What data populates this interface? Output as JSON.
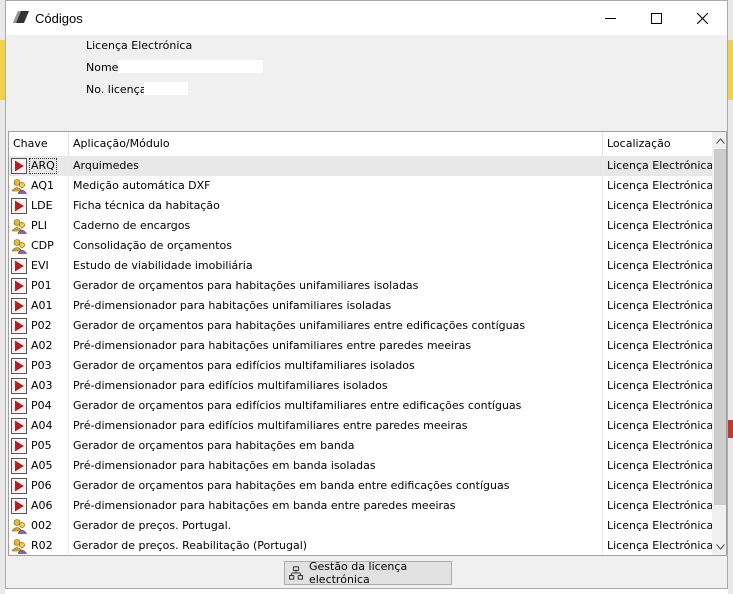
{
  "window": {
    "title": "Códigos"
  },
  "info": {
    "heading": "Licença Electrónica",
    "name_label": "Nome:",
    "name_value": "",
    "license_label": "No. licença:",
    "license_value": ""
  },
  "grid": {
    "columns": {
      "key": "Chave",
      "app": "Aplicação/Módulo",
      "loc": "Localização"
    },
    "rows": [
      {
        "icon": "play-icon",
        "key": "ARQ",
        "app": "Arquimedes",
        "loc": "Licença Electrónica"
      },
      {
        "icon": "users-icon",
        "key": "AQ1",
        "app": "Medição automática DXF",
        "loc": "Licença Electrónica"
      },
      {
        "icon": "play-icon",
        "key": "LDE",
        "app": "Ficha técnica da habitação",
        "loc": "Licença Electrónica"
      },
      {
        "icon": "users-icon",
        "key": "PLI",
        "app": "Caderno de encargos",
        "loc": "Licença Electrónica"
      },
      {
        "icon": "users-icon",
        "key": "CDP",
        "app": "Consolidação de orçamentos",
        "loc": "Licença Electrónica"
      },
      {
        "icon": "play-icon",
        "key": "EVI",
        "app": "Estudo de viabilidade imobiliária",
        "loc": "Licença Electrónica"
      },
      {
        "icon": "play-icon",
        "key": "P01",
        "app": "Gerador de orçamentos para habitações unifamiliares isoladas",
        "loc": "Licença Electrónica"
      },
      {
        "icon": "play-icon",
        "key": "A01",
        "app": "Pré-dimensionador para habitações unifamiliares isoladas",
        "loc": "Licença Electrónica"
      },
      {
        "icon": "play-icon",
        "key": "P02",
        "app": "Gerador de orçamentos para habitações unifamiliares entre edificações contíguas",
        "loc": "Licença Electrónica"
      },
      {
        "icon": "play-icon",
        "key": "A02",
        "app": "Pré-dimensionador para habitações unifamiliares entre paredes meeiras",
        "loc": "Licença Electrónica"
      },
      {
        "icon": "play-icon",
        "key": "P03",
        "app": "Gerador de orçamentos para edifícios multifamiliares isolados",
        "loc": "Licença Electrónica"
      },
      {
        "icon": "play-icon",
        "key": "A03",
        "app": "Pré-dimensionador para edifícios multifamiliares isolados",
        "loc": "Licença Electrónica"
      },
      {
        "icon": "play-icon",
        "key": "P04",
        "app": "Gerador de orçamentos para edifícios multifamiliares entre edificações contíguas",
        "loc": "Licença Electrónica"
      },
      {
        "icon": "play-icon",
        "key": "A04",
        "app": "Pré-dimensionador para edifícios multifamiliares entre paredes meeiras",
        "loc": "Licença Electrónica"
      },
      {
        "icon": "play-icon",
        "key": "P05",
        "app": "Gerador de orçamentos para habitações em banda",
        "loc": "Licença Electrónica"
      },
      {
        "icon": "play-icon",
        "key": "A05",
        "app": "Pré-dimensionador para habitações em banda isoladas",
        "loc": "Licença Electrónica"
      },
      {
        "icon": "play-icon",
        "key": "P06",
        "app": "Gerador de orçamentos para habitações em banda entre edificações contíguas",
        "loc": "Licença Electrónica"
      },
      {
        "icon": "play-icon",
        "key": "A06",
        "app": "Pré-dimensionador para habitações em banda entre paredes meeiras",
        "loc": "Licença Electrónica"
      },
      {
        "icon": "users-icon",
        "key": "002",
        "app": "Gerador de preços. Portugal.",
        "loc": "Licença Electrónica"
      },
      {
        "icon": "users-icon",
        "key": "R02",
        "app": "Gerador de preços. Reabilitação (Portugal)",
        "loc": "Licença Electrónica"
      }
    ]
  },
  "footer": {
    "button_label": "Gestão da licença electrónica"
  }
}
